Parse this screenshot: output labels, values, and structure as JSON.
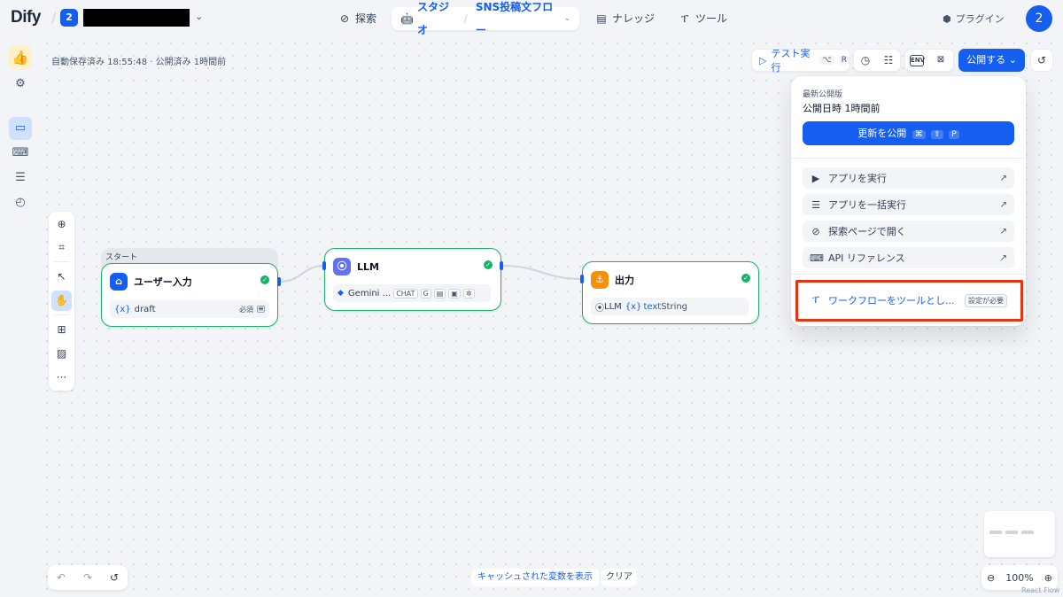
{
  "header": {
    "logo": "Dify",
    "workspace_badge": "2",
    "nav": {
      "explore": "探索",
      "studio": "スタジオ",
      "app_name": "SNS投稿文フロー",
      "knowledge": "ナレッジ",
      "tools": "ツール"
    },
    "plugin": "プラグイン",
    "avatar": "2"
  },
  "canvas": {
    "autosave": "自動保存済み 18:55:48 · 公開済み 1時間前"
  },
  "toolbar": {
    "test_run": "テスト実行",
    "shortcut_mod": "⌥",
    "shortcut_key": "R",
    "env": "ENV",
    "publish": "公開する"
  },
  "publish_menu": {
    "latest_label": "最新公開版",
    "published_time": "公開日時 1時間前",
    "update_button": "更新を公開",
    "update_shortcut_1": "⌘",
    "update_shortcut_2": "⇧",
    "update_shortcut_3": "P",
    "items": [
      {
        "label": "アプリを実行"
      },
      {
        "label": "アプリを一括実行"
      },
      {
        "label": "探索ページで開く"
      },
      {
        "label": "API リファレンス"
      }
    ],
    "workflow_as_tool": "ワークフローをツールとし...",
    "config_required": "設定が必要"
  },
  "nodes": {
    "start": {
      "tag": "スタート",
      "title": "ユーザー入力",
      "var_name": "draft",
      "var_prefix": "{x}",
      "required": "必須"
    },
    "llm": {
      "title": "LLM",
      "model": "Gemini ...",
      "chip": "CHAT"
    },
    "output": {
      "title": "出力",
      "source": "LLM",
      "var_prefix": "{x}",
      "var": "text",
      "type": "String"
    }
  },
  "bottom": {
    "cache_vars": "キャッシュされた変数を表示",
    "clear": "クリア",
    "zoom": "100%",
    "attribution": "React Flow"
  },
  "colors": {
    "accent": "#155eef",
    "success": "#17b26a",
    "highlight": "#e63312"
  }
}
